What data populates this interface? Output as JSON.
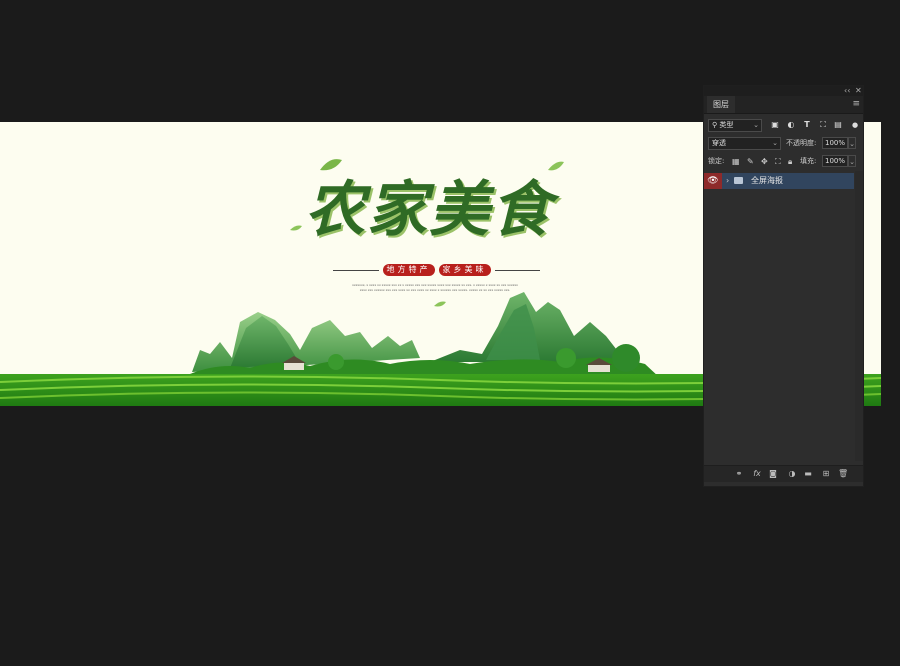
{
  "poster": {
    "title": "农家美食",
    "tags": [
      "地方特产",
      "家乡美味"
    ],
    "tiny_copy": "xxxxxxx, x xxxx xx xxxxx xxx xx x xxxxx xxx xxx xxxxx xxxx xxx xxxxx xx xxx. x xxxxx x xxxx xx xxx xxxxxx xxxx xxx xxxxxx xxx xxx xxxx xx xxx xxxx xx xxxx x xxxxxx xxx xxxxx. xxxxx xx xx xxx xxxxx xxx."
  },
  "layers_panel": {
    "collapse_icon": "double-chevron-icon",
    "close_icon": "close-icon",
    "tab_label": "图层",
    "menu_icon": "hamburger-menu-icon",
    "filter": {
      "search_icon": "search-icon",
      "kind_label": "类型",
      "icons": [
        "pixel-filter-icon",
        "adjustment-filter-icon",
        "type-filter-icon",
        "shape-filter-icon",
        "smart-object-filter-icon",
        "filter-toggle-icon"
      ]
    },
    "blend_mode": "穿透",
    "opacity_label": "不透明度:",
    "opacity_value": "100%",
    "lock_label": "锁定:",
    "lock_icons": [
      "lock-transparent-icon",
      "lock-image-icon",
      "lock-position-icon",
      "lock-artboard-icon",
      "lock-all-icon"
    ],
    "fill_label": "填充:",
    "fill_value": "100%",
    "layers": [
      {
        "name": "全屏海报",
        "type": "group",
        "visible": true,
        "selected": true
      }
    ],
    "footer_icons": [
      "link-layers-icon",
      "fx-icon",
      "add-mask-icon",
      "adjustment-layer-icon",
      "new-group-icon",
      "new-layer-icon",
      "delete-icon"
    ],
    "fx_label": "fx"
  },
  "colors": {
    "app_background": "#1b1b1b",
    "poster_background": "#fdfdf0",
    "panel_background": "#2d2d2d",
    "selected_layer": "#31455e",
    "eye_highlight": "#8e2a2a",
    "title_green": "#2f6b25",
    "tag_red": "#b8201c"
  }
}
